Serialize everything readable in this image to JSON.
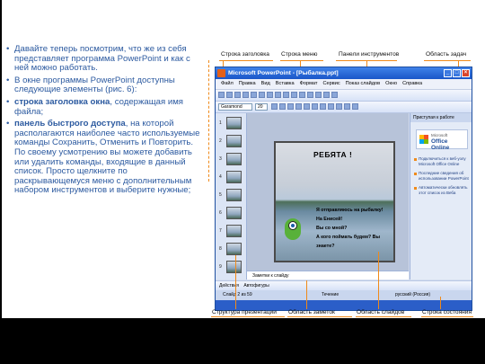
{
  "bullets": [
    {
      "plain": "Давайте теперь посмотрим, что же из себя представляет программа PowerPoint и как с ней можно работать.",
      "bold": ""
    },
    {
      "plain": "В окне программы PowerPoint доступны следующие элементы (рис. 6):",
      "bold": ""
    },
    {
      "bold": "строка заголовка окна",
      "plain": ", содержащая имя файла;"
    },
    {
      "bold": "панель быстрого доступа",
      "plain": ", на которой располагаются наиболее часто используемые команды Сохранить, Отменить и Повторить. По своему усмотрению вы можете добавить или удалить команды, входящие в данный список. Просто щелкните по раскрывающемуся меню с дополнительным набором инструментов и выберите нужные;"
    }
  ],
  "labels": {
    "title_bar": "Строка заголовка",
    "menu_bar": "Строка меню",
    "toolbars": "Панели инструментов",
    "task_pane": "Область задач",
    "structure": "Структура презентации",
    "notes_area": "Область заметок",
    "slides_area": "Область слайдов",
    "status_bar": "Строка состояния"
  },
  "window": {
    "title": "Microsoft PowerPoint - [Рыбалка.ppt]",
    "menu": [
      "Файл",
      "Правка",
      "Вид",
      "Вставка",
      "Формат",
      "Сервис",
      "Показ слайдов",
      "Окно",
      "Справка"
    ],
    "font": "Garamond",
    "font_size": "20",
    "slide_numbers": [
      "1",
      "2",
      "3",
      "4",
      "5",
      "6",
      "7",
      "8",
      "9"
    ],
    "slide_title": "РЕБЯТА !",
    "slide_lines": [
      "Я отправляюсь на рыбалку!",
      "На Енисей!",
      "Вы со мной?",
      "А кого поймать будем? Вы знаете?"
    ],
    "notes_placeholder": "Заметки к слайду",
    "task_pane_title": "Приступая к работе",
    "office_online_small": "Microsoft",
    "office_online": "Office Online",
    "task_links": [
      "Подключиться к веб-узлу Microsoft Office Online",
      "Последние сведения об использовании PowerPoint",
      "Автоматически обновлять этот список из Веба"
    ],
    "draw_label": "Действия",
    "autoshapes": "Автофигуры",
    "status_slide": "Слайд 2 из 59",
    "status_design": "Течение",
    "status_lang": "русский (Россия)"
  }
}
